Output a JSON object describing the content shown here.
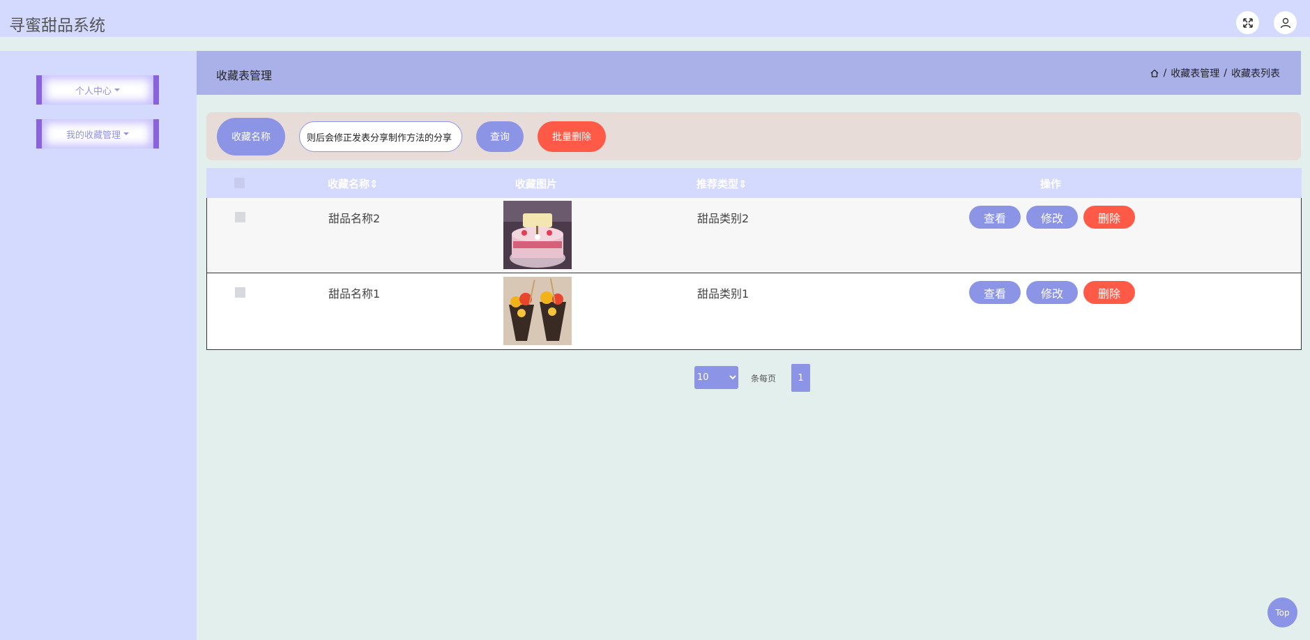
{
  "app": {
    "title": "寻蜜甜品系统"
  },
  "header": {
    "fullscreen_icon": "expand-icon",
    "user_icon": "user-icon"
  },
  "sidebar": {
    "items": [
      {
        "label": "个人中心"
      },
      {
        "label": "我的收藏管理"
      }
    ]
  },
  "page": {
    "title": "收藏表管理",
    "breadcrumb": [
      "收藏表管理",
      "收藏表列表"
    ],
    "breadcrumb_sep": "/"
  },
  "search": {
    "label": "收藏名称",
    "value": "则后会修正发表分享制作方法的分享",
    "query_button": "查询",
    "batch_delete_button": "批量删除"
  },
  "table": {
    "columns": [
      "收藏名称",
      "收藏图片",
      "推荐类型",
      "操作"
    ],
    "rows": [
      {
        "name": "甜品名称2",
        "image": "cake-photo",
        "type": "甜品类别2"
      },
      {
        "name": "甜品名称1",
        "image": "fruit-parfait-photo",
        "type": "甜品类别1"
      }
    ],
    "actions": {
      "view": "查看",
      "edit": "修改",
      "delete": "删除"
    }
  },
  "pagination": {
    "page_size": "10",
    "per_page_label": "条每页",
    "current_page": "1"
  },
  "back_to_top": "Top",
  "colors": {
    "header_bg": "#d4d9fe",
    "primary": "#8c94e6",
    "danger": "#ff5a47",
    "content_bg": "#e3efec"
  }
}
